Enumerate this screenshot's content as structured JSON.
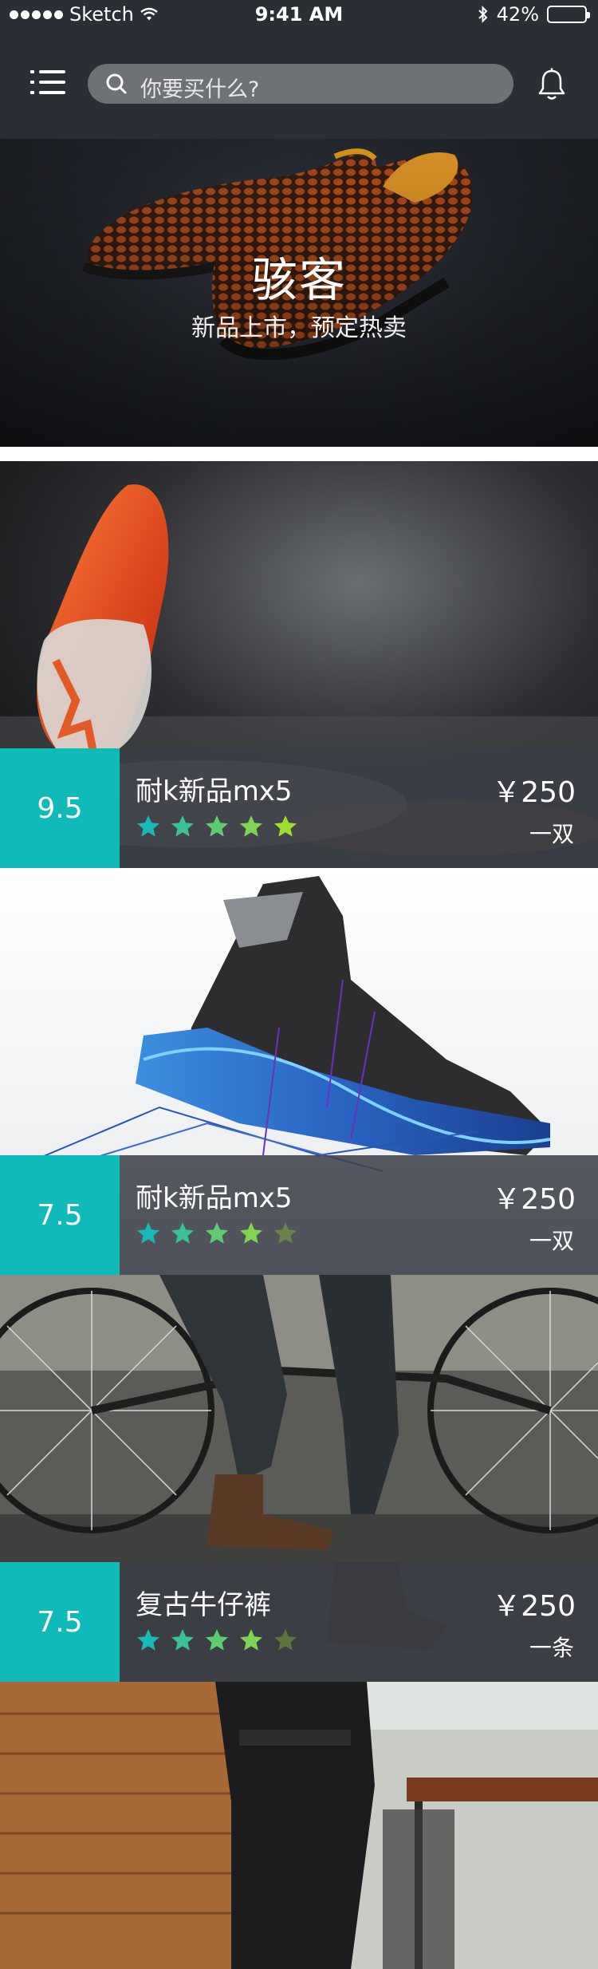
{
  "status": {
    "carrier": "Sketch",
    "time": "9:41 AM",
    "battery": "42%",
    "battery_level": 0.42
  },
  "header": {
    "search_placeholder": "你要买什么?"
  },
  "hero": {
    "title": "骇客",
    "subtitle": "新品上市，预定热卖"
  },
  "products": [
    {
      "score": "9.5",
      "name": "耐k新品mx5",
      "price": "￥250",
      "unit": "一双",
      "rating": 5
    },
    {
      "score": "7.5",
      "name": "耐k新品mx5",
      "price": "￥250",
      "unit": "一双",
      "rating": 4
    },
    {
      "score": "7.5",
      "name": "复古牛仔裤",
      "price": "￥250",
      "unit": "一条",
      "rating": 4
    }
  ],
  "colors": {
    "accent": "#0fbab8",
    "header_bg": "#2a2e35",
    "star_start": "#19b9b6",
    "star_end": "#9ede2f"
  }
}
